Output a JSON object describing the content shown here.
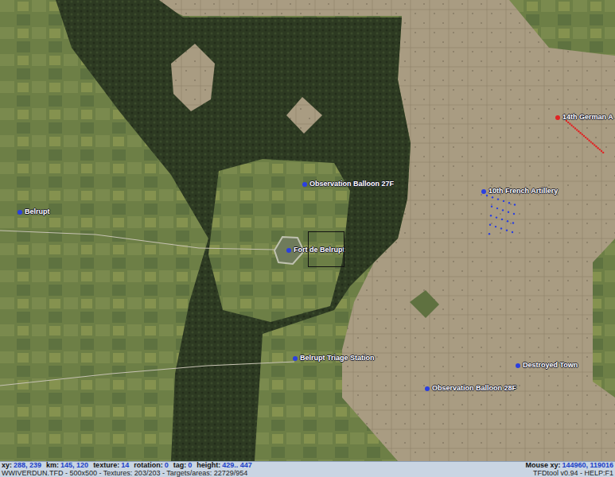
{
  "map": {
    "pins": [
      {
        "label": "14th German A",
        "color": "#e02424",
        "selected": false
      },
      {
        "label": "10th French Artillery",
        "color": "#2a3fe0",
        "selected": false
      },
      {
        "label": "Observation Balloon 27F",
        "color": "#2a3fe0",
        "selected": false
      },
      {
        "label": "Belrupt",
        "color": "#2a3fe0",
        "selected": false
      },
      {
        "label": "Fort de Belrupt",
        "color": "#2a3fe0",
        "selected": true
      },
      {
        "label": "Belrupt Triage Station",
        "color": "#2a3fe0",
        "selected": false
      },
      {
        "label": "Destroyed Town",
        "color": "#2a3fe0",
        "selected": false
      },
      {
        "label": "Observation Balloon 28F",
        "color": "#2a3fe0",
        "selected": false
      }
    ]
  },
  "status_bar": {
    "fields": [
      {
        "label": "xy:",
        "value": "288, 239"
      },
      {
        "label": "km:",
        "value": "145, 120"
      },
      {
        "label": "texture:",
        "value": "14"
      },
      {
        "label": "rotation:",
        "value": "0"
      },
      {
        "label": "tag:",
        "value": "0"
      },
      {
        "label": "height:",
        "value": "429.. 447"
      }
    ],
    "mouse": {
      "label": "Mouse xy:",
      "value": "144960, 119016"
    },
    "file_info": "WWIVERDUN.TFD - 500x500 - Textures: 203/203 - Targets/areas: 22729/954",
    "app": "TFDtool v0.94 - HELP:F1"
  }
}
